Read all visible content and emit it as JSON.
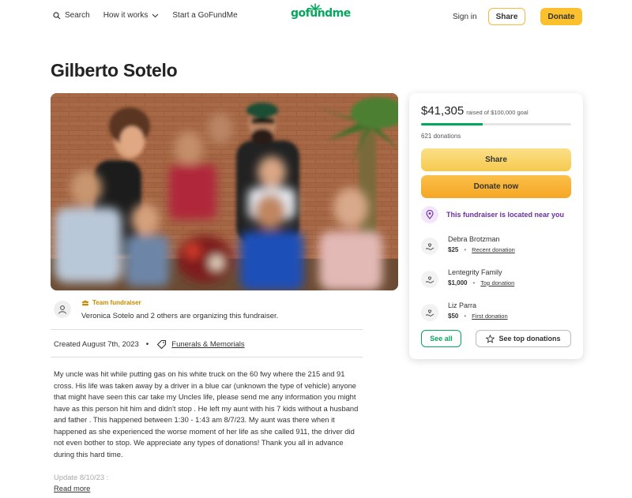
{
  "header": {
    "search_label": "Search",
    "how_it_works_label": "How it works",
    "start_label": "Start a GoFundMe",
    "logo_text": "gofundme",
    "signin_label": "Sign in",
    "share_label": "Share",
    "donate_label": "Donate"
  },
  "campaign": {
    "title": "Gilberto Sotelo",
    "team_label": "Team fundraiser",
    "organizer_text": "Veronica Sotelo and 2 others are organizing this fundraiser.",
    "created": "Created August 7th, 2023",
    "category": "Funerals & Memorials",
    "story": "My uncle was hit while putting gas on his white truck on the 60 fwy where the 215 and 91 cross. His life was taken away by a driver in a blue car (unknown the type of vehicle) anyone that might have seen this car take my Uncles life, please send me any information you might have as this person hit him and didn't stop . He left my aunt with his 7 kids without a husband and father . This happened between 1:30 - 1:43 am 8/7/23. My aunt was there when it happened as she experienced the worse moment of her life as she called 911, the driver did not even bother to stop. We appreciate any types of donations! Thank you all in advance during this hard time.",
    "update": "Update 8/10/23 :",
    "read_more": "Read more"
  },
  "donation_card": {
    "raised": "$41,305",
    "goal_text": "raised of $100,000 goal",
    "progress_fraction": 0.413,
    "donations_count": "621 donations",
    "share_label": "Share",
    "donate_now_label": "Donate now",
    "near_you_text": "This fundraiser is located near you",
    "donors": [
      {
        "name": "Debra Brotzman",
        "amount": "$25",
        "kind": "Recent donation"
      },
      {
        "name": "Lentegrity Family",
        "amount": "$1,000",
        "kind": "Top donation"
      },
      {
        "name": "Liz Parra",
        "amount": "$50",
        "kind": "First donation"
      }
    ],
    "see_all_label": "See all",
    "see_top_label": "See top donations"
  },
  "colors": {
    "brand_green": "#02a95c",
    "donate_yellow": "#fbc02d",
    "purple": "#6b2fa0"
  }
}
